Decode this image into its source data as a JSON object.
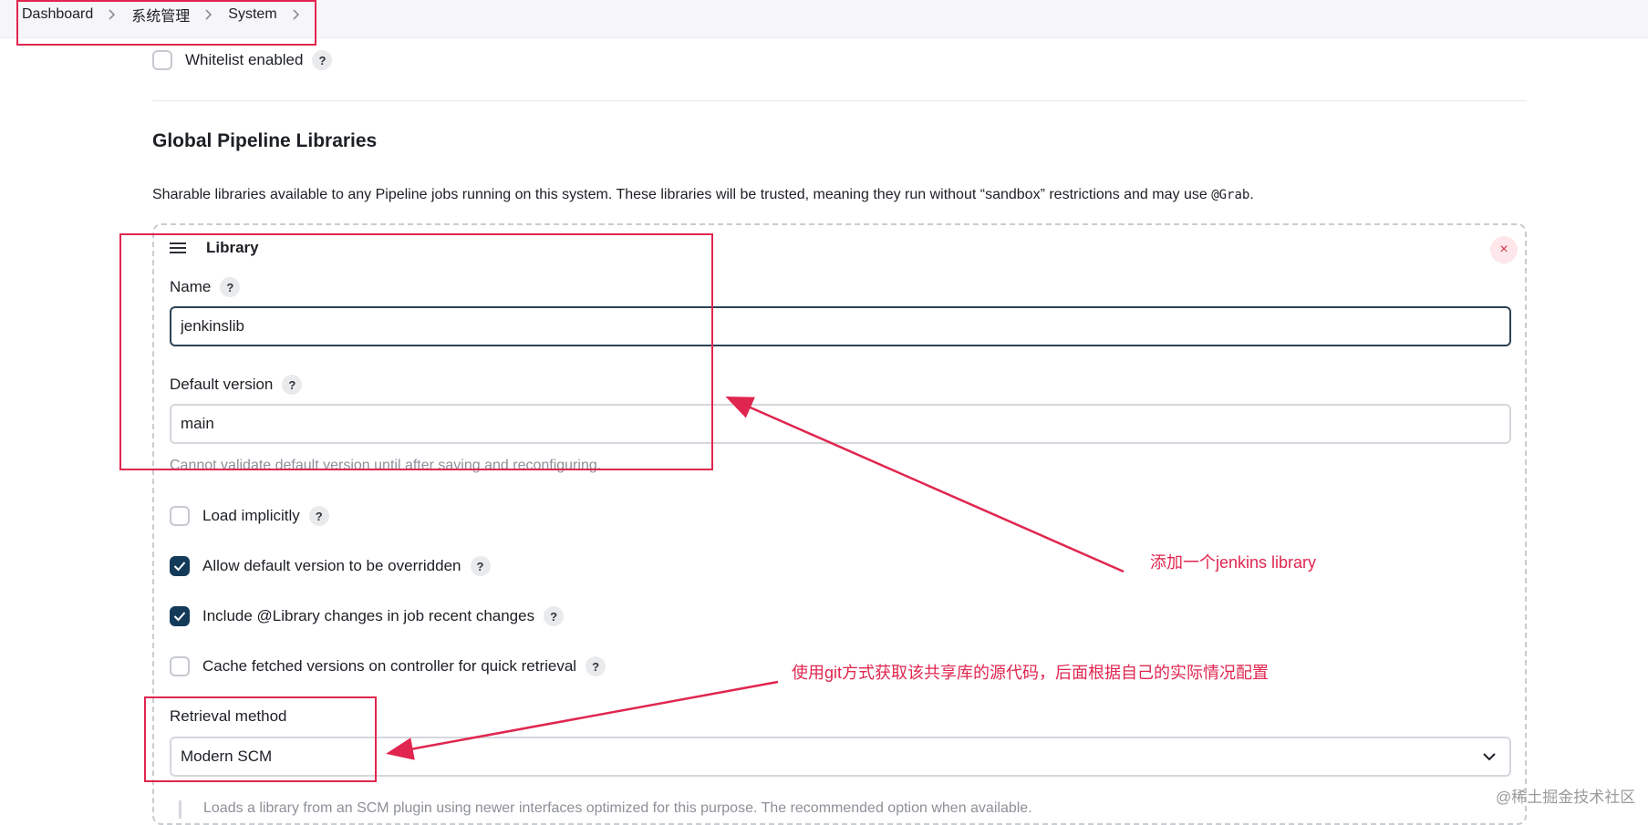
{
  "breadcrumb": [
    "Dashboard",
    "系统管理",
    "System"
  ],
  "whitelist": {
    "label": "Whitelist enabled",
    "checked": false
  },
  "section": {
    "title": "Global Pipeline Libraries",
    "description_pre": "Sharable libraries available to any Pipeline jobs running on this system. These libraries will be trusted, meaning they run without “sandbox” restrictions and may use ",
    "description_code": "@Grab",
    "description_post": "."
  },
  "library": {
    "header": "Library",
    "name_label": "Name",
    "name_value": "jenkinslib",
    "default_version_label": "Default version",
    "default_version_value": "main",
    "default_version_hint": "Cannot validate default version until after saving and reconfiguring.",
    "options": [
      {
        "label": "Load implicitly",
        "checked": false
      },
      {
        "label": "Allow default version to be overridden",
        "checked": true
      },
      {
        "label": "Include @Library changes in job recent changes",
        "checked": true
      },
      {
        "label": "Cache fetched versions on controller for quick retrieval",
        "checked": false
      }
    ],
    "retrieval_label": "Retrieval method",
    "retrieval_value": "Modern SCM",
    "retrieval_desc": "Loads a library from an SCM plugin using newer interfaces optimized for this purpose. The recommended option when available."
  },
  "help_symbol": "?",
  "close_symbol": "×",
  "annotations": {
    "add_library": "添加一个jenkins  library",
    "git_method": "使用git方式获取该共享库的源代码，后面根据自己的实际情况配置",
    "color": "#e0264f"
  },
  "watermark": "@稀土掘金技术社区",
  "colors": {
    "checked": "#143a5a",
    "accent_red": "#e0264f"
  }
}
